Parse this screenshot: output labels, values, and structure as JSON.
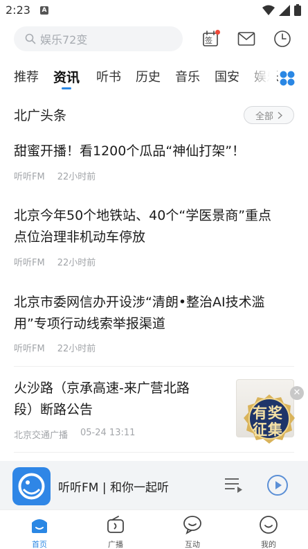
{
  "status_bar": {
    "time": "2:23",
    "notification_badge": "A"
  },
  "search": {
    "placeholder": "娱乐72变"
  },
  "top_icons": {
    "checkin_label": "签"
  },
  "tabs": [
    {
      "label": "推荐",
      "active": false
    },
    {
      "label": "资讯",
      "active": true
    },
    {
      "label": "听书",
      "active": false
    },
    {
      "label": "历史",
      "active": false
    },
    {
      "label": "音乐",
      "active": false
    },
    {
      "label": "国安",
      "active": false
    },
    {
      "label": "娱乐",
      "active": false
    }
  ],
  "section": {
    "title": "北广头条",
    "all_label": "全部"
  },
  "news": [
    {
      "title": "甜蜜开播！看1200个瓜品“神仙打架”！",
      "source": "听听FM",
      "time": "22小时前"
    },
    {
      "title_line1": "北京今年50个地铁站、40个“学医景商”重点",
      "title_line2": "点位治理非机动车停放",
      "source": "听听FM",
      "time": "22小时前"
    },
    {
      "title_line1": "北京市委网信办开设涉“清朗•整治AI技术滥",
      "title_line2": "用”专项行动线索举报渠道",
      "source": "听听FM",
      "time": "22小时前"
    },
    {
      "title_line1": "火沙路（京承高速-来广营北路",
      "title_line2": "段）断路公告",
      "source": "北京交通广播",
      "time": "05-24 13:11"
    }
  ],
  "promo_badge": {
    "line1": "有奖",
    "line2": "征集"
  },
  "player": {
    "title": "听听FM | 和你一起听"
  },
  "bottom_nav": [
    {
      "label": "首页",
      "active": true
    },
    {
      "label": "广播",
      "active": false
    },
    {
      "label": "互动",
      "active": false
    },
    {
      "label": "我的",
      "active": false
    }
  ],
  "colors": {
    "accent": "#2a87e4",
    "badge_dot": "#f04a3a",
    "promo_gold": "#d9b35a",
    "promo_navy": "#1f3569"
  }
}
